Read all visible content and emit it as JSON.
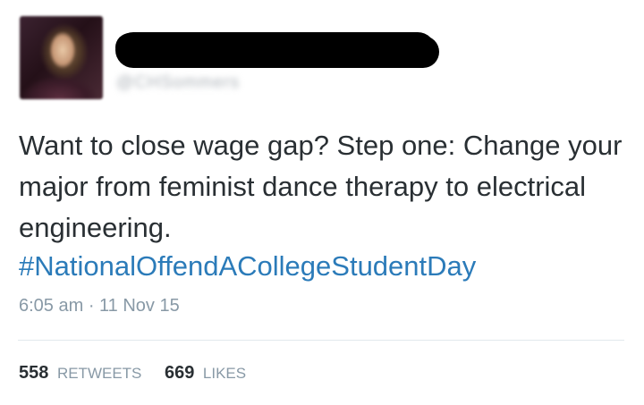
{
  "tweet": {
    "author": {
      "handle": "@CHSommers",
      "avatar_icon": "profile-photo"
    },
    "text": "Want to close wage gap? Step one: Change your major from feminist dance therapy to electrical engineering.",
    "hashtag": "#NationalOffendACollegeStudentDay",
    "timestamp": "6:05 am · 11 Nov 15",
    "stats": {
      "retweets": {
        "count": "558",
        "label": "RETWEETS"
      },
      "likes": {
        "count": "669",
        "label": "LIKES"
      }
    },
    "colors": {
      "text": "#292f33",
      "link": "#2b7bb9",
      "muted": "#8899a6",
      "divider": "#e1e8ed",
      "redaction": "#000000"
    }
  }
}
